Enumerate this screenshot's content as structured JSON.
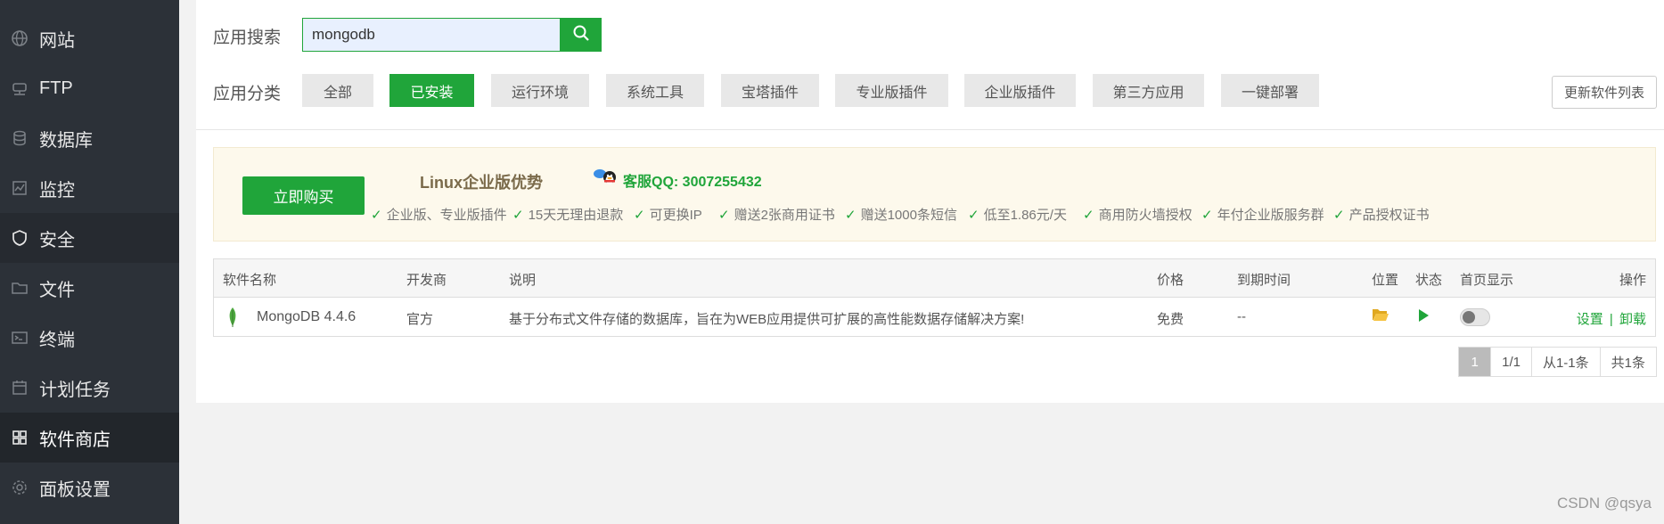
{
  "sidebar": {
    "items": [
      {
        "label": "网站",
        "icon": "globe-icon"
      },
      {
        "label": "FTP",
        "icon": "ftp-icon"
      },
      {
        "label": "数据库",
        "icon": "database-icon"
      },
      {
        "label": "监控",
        "icon": "monitor-icon"
      },
      {
        "label": "安全",
        "icon": "shield-icon"
      },
      {
        "label": "文件",
        "icon": "folder-icon"
      },
      {
        "label": "终端",
        "icon": "terminal-icon"
      },
      {
        "label": "计划任务",
        "icon": "calendar-icon"
      },
      {
        "label": "软件商店",
        "icon": "grid-icon"
      },
      {
        "label": "面板设置",
        "icon": "gear-icon"
      }
    ],
    "active_index": 8
  },
  "search": {
    "label": "应用搜索",
    "value": "mongodb"
  },
  "categories": {
    "label": "应用分类",
    "items": [
      "全部",
      "已安装",
      "运行环境",
      "系统工具",
      "宝塔插件",
      "专业版插件",
      "企业版插件",
      "第三方应用",
      "一键部署"
    ],
    "active_index": 1
  },
  "refresh_label": "更新软件列表",
  "banner": {
    "buy_label": "立即购买",
    "title": "Linux企业版优势",
    "qq_text": "客服QQ: 3007255432",
    "features": [
      "企业版、专业版插件",
      "15天无理由退款",
      "可更换IP",
      "赠送2张商用证书",
      "赠送1000条短信",
      "低至1.86元/天",
      "商用防火墙授权",
      "年付企业版服务群",
      "产品授权证书"
    ]
  },
  "table": {
    "headers": [
      "软件名称",
      "开发商",
      "说明",
      "价格",
      "到期时间",
      "位置",
      "状态",
      "首页显示",
      "操作"
    ],
    "rows": [
      {
        "name": "MongoDB 4.4.6",
        "developer": "官方",
        "description": "基于分布式文件存储的数据库，旨在为WEB应用提供可扩展的高性能数据存储解决方案!",
        "price": "免费",
        "expire": "--",
        "actions": {
          "settings": "设置",
          "separator": "|",
          "uninstall": "卸载"
        }
      }
    ]
  },
  "pagination": {
    "current": "1",
    "pages": "1/1",
    "range": "从1-1条",
    "total": "共1条"
  },
  "watermark": "CSDN @qsya",
  "colors": {
    "accent": "#20a53a",
    "sidebar_bg": "#2c3138"
  }
}
